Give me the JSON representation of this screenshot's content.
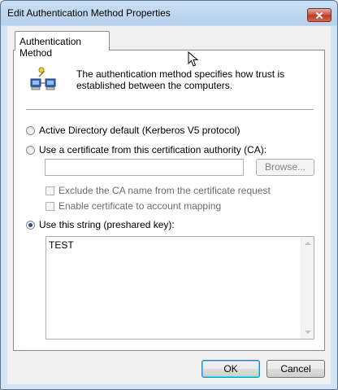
{
  "window": {
    "title": "Edit Authentication Method Properties"
  },
  "tabs": [
    {
      "label": "Authentication Method",
      "selected": true
    }
  ],
  "panel": {
    "description": "The authentication method specifies how trust is established between the computers.",
    "icon": "network-computers-icon",
    "options": {
      "ad_default": {
        "label": "Active Directory default (Kerberos V5 protocol)",
        "checked": false
      },
      "certificate": {
        "label": "Use a certificate from this certification authority (CA):",
        "checked": false
      },
      "preshared": {
        "label": "Use this string (preshared key):",
        "checked": true
      }
    },
    "ca_input_value": "",
    "browse_label": "Browse...",
    "checkboxes": {
      "exclude_ca": {
        "label": "Exclude the CA name from the certificate request",
        "checked": false,
        "enabled": false
      },
      "cert_mapping": {
        "label": "Enable certificate to account mapping",
        "checked": false,
        "enabled": false
      }
    },
    "preshared_value": "TEST"
  },
  "buttons": {
    "ok": "OK",
    "cancel": "Cancel"
  },
  "colors": {
    "titlebar": "#b7d1ec",
    "close_button": "#c8513c",
    "dialog_bg": "#f0f0f0",
    "radio_dot": "#2b4f7a"
  }
}
